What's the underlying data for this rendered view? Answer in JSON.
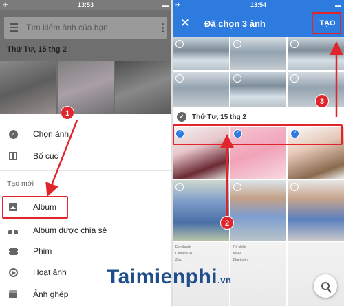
{
  "left": {
    "status": {
      "time": "13:53",
      "battery": "▬"
    },
    "search_placeholder": "Tìm kiếm ảnh của bạn",
    "date_header": "Thứ Tư, 15 thg 2",
    "menu_top": [
      {
        "label": "Chọn ảnh",
        "icon": "check-circle-icon"
      },
      {
        "label": "Bố cục",
        "icon": "layout-icon"
      }
    ],
    "section_title": "Tạo mới",
    "menu_create": [
      {
        "label": "Album",
        "icon": "album-icon"
      },
      {
        "label": "Album được chia sẻ",
        "icon": "shared-album-icon"
      },
      {
        "label": "Phim",
        "icon": "movie-icon"
      },
      {
        "label": "Hoạt ảnh",
        "icon": "animation-icon"
      },
      {
        "label": "Ảnh ghép",
        "icon": "collage-icon"
      }
    ]
  },
  "right": {
    "status": {
      "time": "13:54"
    },
    "title": "Đã chọn 3 ảnh",
    "create_button": "TẠO",
    "date_header": "Thứ Tư, 15 thg 2",
    "mini_settings": [
      "Facebook",
      "Camera360",
      "Zalo",
      "Cá nhân",
      "Wi-Fi",
      "Bluetooth"
    ]
  },
  "annotations": {
    "step1": "1",
    "step2": "2",
    "step3": "3"
  },
  "watermark": {
    "brand": "Taimienphi",
    "tld": ".vn"
  },
  "colors": {
    "accent": "#2e7be0",
    "highlight": "#e0262c"
  }
}
